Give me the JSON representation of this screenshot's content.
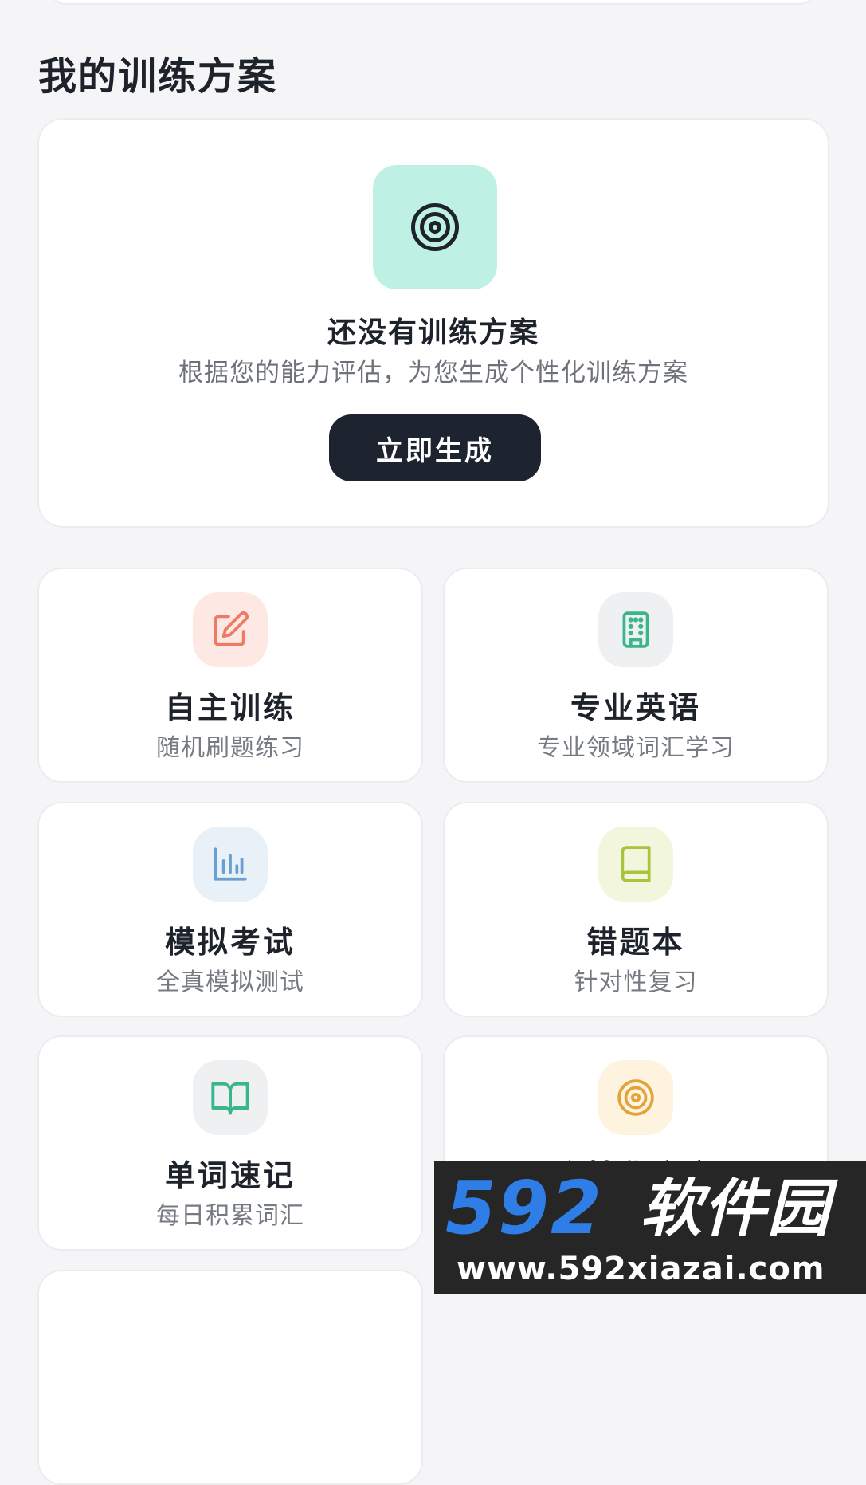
{
  "section": {
    "title": "我的训练方案"
  },
  "plan": {
    "icon": "target-icon",
    "icon_color": "#1d222b",
    "icon_bg": "#bff0e4",
    "heading": "还没有训练方案",
    "subtitle": "根据您的能力评估，为您生成个性化训练方案",
    "button_label": "立即生成"
  },
  "features": [
    {
      "title": "自主训练",
      "subtitle": "随机刷题练习",
      "icon": "edit-icon",
      "color": "#ee7a63",
      "bg": "#fde8e3"
    },
    {
      "title": "专业英语",
      "subtitle": "专业领域词汇学习",
      "icon": "building-icon",
      "color": "#3bb58a",
      "bg": "#eef0f2"
    },
    {
      "title": "模拟考试",
      "subtitle": "全真模拟测试",
      "icon": "bar-chart-icon",
      "color": "#6aa0cf",
      "bg": "#e9f1f8"
    },
    {
      "title": "错题本",
      "subtitle": "针对性复习",
      "icon": "book-icon",
      "color": "#a8c43a",
      "bg": "#f1f6dd"
    },
    {
      "title": "单词速记",
      "subtitle": "每日积累词汇",
      "icon": "open-book-icon",
      "color": "#3bb58a",
      "bg": "#eef0f2"
    },
    {
      "title": "个性化方案",
      "subtitle": "",
      "icon": "target-icon",
      "color": "#e3a33b",
      "bg": "#fdf3df"
    }
  ],
  "watermark": {
    "number": "592",
    "name": "软件园",
    "url": "www.592xiazai.com"
  }
}
